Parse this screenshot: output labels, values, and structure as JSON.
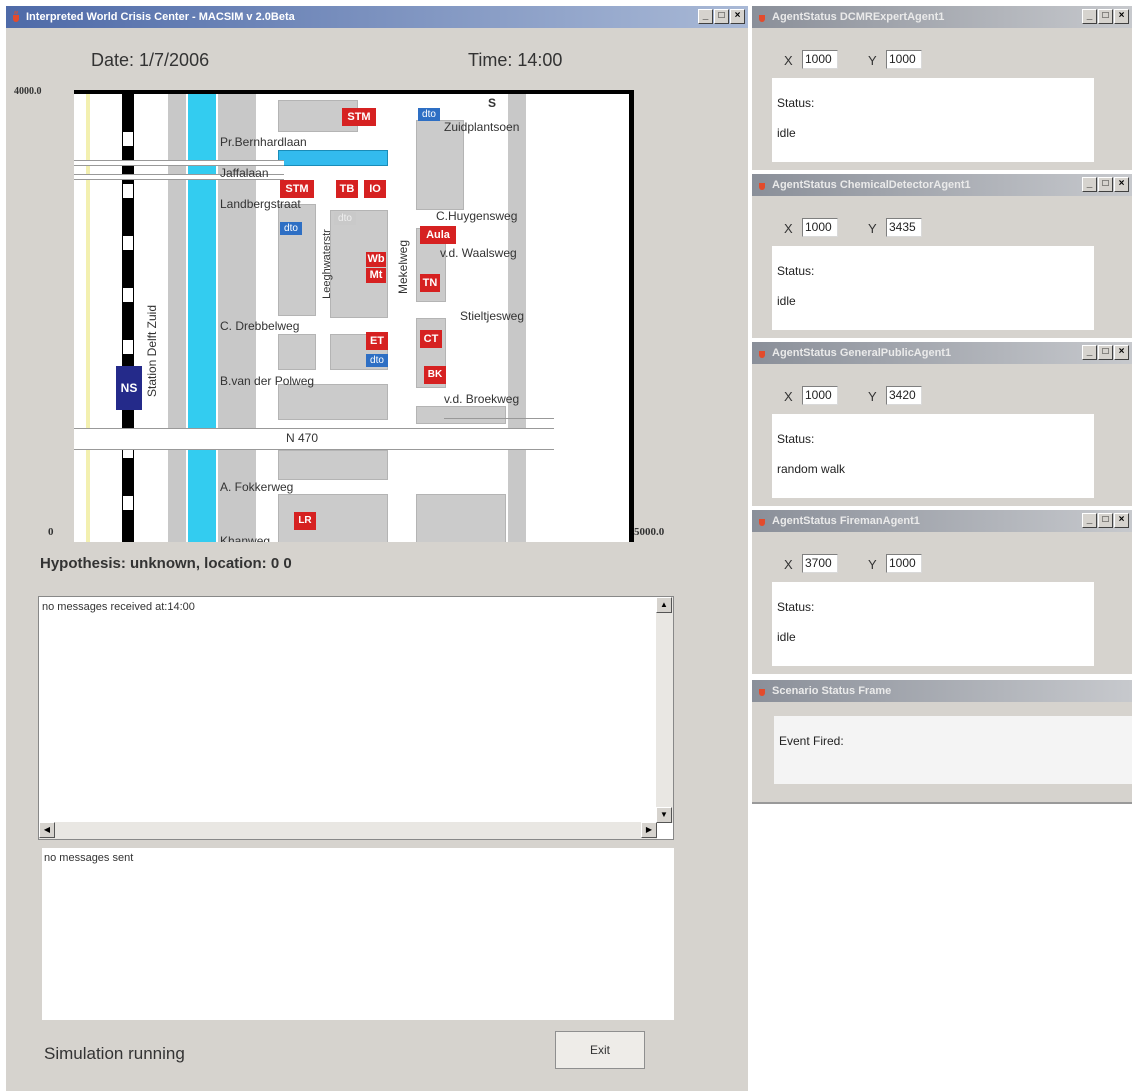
{
  "main": {
    "title": "Interpreted World Crisis Center - MACSIM v 2.0Beta",
    "date": "Date: 1/7/2006",
    "time": "Time: 14:00",
    "y_max": "4000.0",
    "y_min": "0",
    "x_max": "5000.0",
    "hypothesis": "Hypothesis: unknown, location: 0 0",
    "received": "no messages received at:14:00",
    "sent": "no messages sent",
    "status": "Simulation running",
    "exit_label": "Exit"
  },
  "map": {
    "streets": {
      "bernhardlaan": "Pr.Bernhardlaan",
      "jaffalaan": "Jaffalaan",
      "landbergstraat": "Landbergstraat",
      "leeghwaterstr": "Leeghwaterstr",
      "mekelweg": "Mekelweg",
      "zuidplantsoen": "Zuidplantsoen",
      "huygensweg": "C.Huygensweg",
      "waalsweg": "v.d. Waalsweg",
      "stieltjesweg": "Stieltjesweg",
      "drebbelweg": "C. Drebbelweg",
      "polweg": "B.van der Polweg",
      "broekweg": "v.d. Broekweg",
      "n470": "N 470",
      "fokkerweg": "A. Fokkerweg",
      "station": "Station Delft Zuid",
      "khanweg": "Khanweg"
    },
    "tags": {
      "stm1": "STM",
      "stm2": "STM",
      "tb": "TB",
      "io": "IO",
      "aula": "Aula",
      "wb": "Wb",
      "mt": "Mt",
      "tn": "TN",
      "ct": "CT",
      "et": "ET",
      "bk": "BK",
      "lr": "LR",
      "ns": "NS",
      "s": "S"
    },
    "dto": "dto"
  },
  "agents": [
    {
      "title": "AgentStatus DCMRExpertAgent1",
      "x": "1000",
      "y": "1000",
      "status_label": "Status:",
      "status": "idle"
    },
    {
      "title": "AgentStatus ChemicalDetectorAgent1",
      "x": "1000",
      "y": "3435",
      "status_label": "Status:",
      "status": "idle"
    },
    {
      "title": "AgentStatus GeneralPublicAgent1",
      "x": "1000",
      "y": "3420",
      "status_label": "Status:",
      "status": "random walk"
    },
    {
      "title": "AgentStatus FiremanAgent1",
      "x": "3700",
      "y": "1000",
      "status_label": "Status:",
      "status": "idle"
    }
  ],
  "labels": {
    "x": "X",
    "y": "Y"
  },
  "scenario": {
    "title": "Scenario Status Frame",
    "event": "Event Fired:"
  }
}
